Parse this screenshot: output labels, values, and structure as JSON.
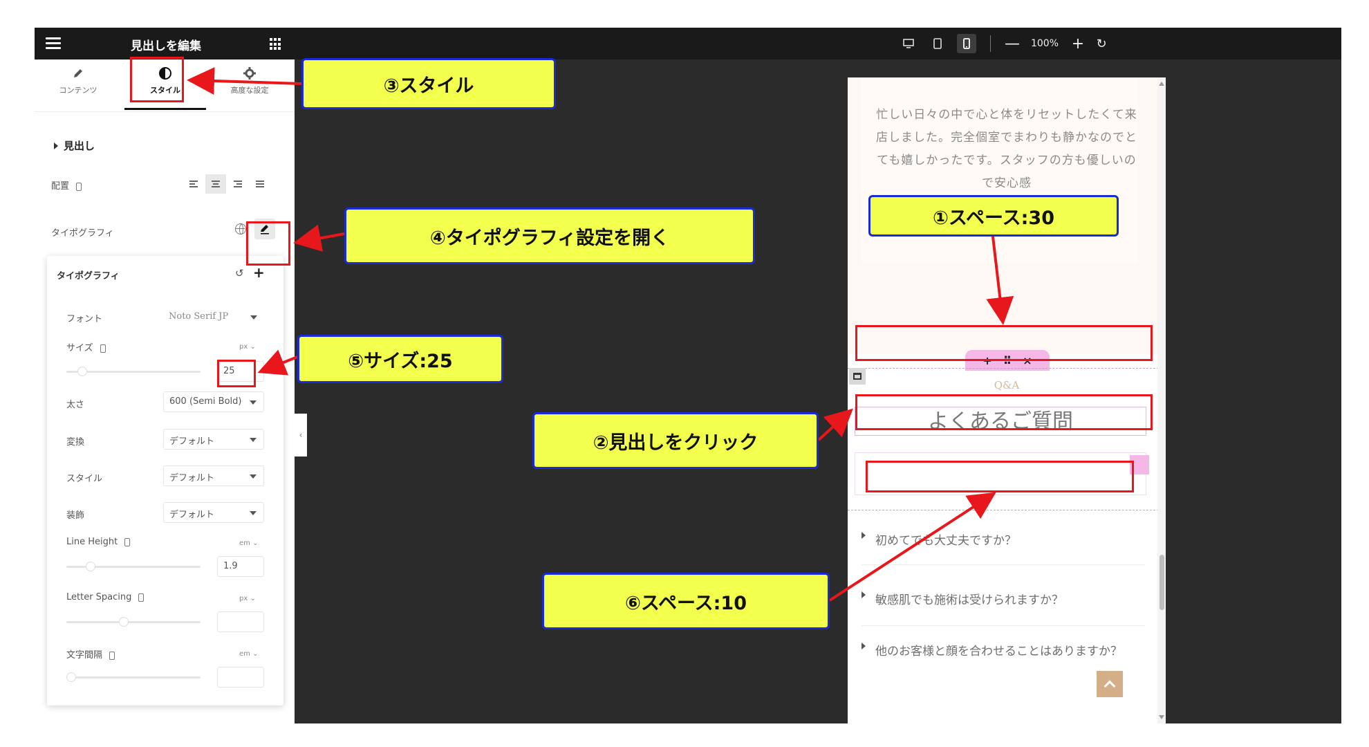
{
  "topbar": {
    "title": "見出しを編集",
    "zoom": "100%",
    "minus": "—",
    "plus": "+",
    "undo": "↻"
  },
  "tabs": [
    {
      "label": "コンテンツ",
      "icon": "pencil-icon"
    },
    {
      "label": "スタイル",
      "icon": "contrast-icon"
    },
    {
      "label": "高度な設定",
      "icon": "gear-icon"
    }
  ],
  "section": {
    "heading": "見出し",
    "align_label": "配置",
    "typography_label": "タイポグラフィ"
  },
  "typography": {
    "title": "タイポグラフィ",
    "reset": "↺",
    "add": "+",
    "font_label": "フォント",
    "font_value": "Noto Serif JP",
    "size_label": "サイズ",
    "size_unit": "px ⌄",
    "size_value": "25",
    "weight_label": "太さ",
    "weight_value": "600 (Semi Bold)",
    "transform_label": "変換",
    "transform_value": "デフォルト",
    "style_label": "スタイル",
    "style_value": "デフォルト",
    "decoration_label": "装飾",
    "decoration_value": "デフォルト",
    "line_height_label": "Line Height",
    "line_height_unit": "em ⌄",
    "line_height_value": "1.9",
    "letter_spacing_label": "Letter Spacing",
    "letter_spacing_unit": "px ⌄",
    "word_spacing_label": "文字間隔",
    "word_spacing_unit": "em ⌄"
  },
  "preview": {
    "testimonial_text": "忙しい日々の中で心と体をリセットしたくて来店しました。完全個室でまわりも静かなのでとても嬉しかったです。スタッフの方も優しいので安心感",
    "handle_plus": "+",
    "handle_move": "⠿",
    "handle_close": "×",
    "kicker": "Q&A",
    "heading": "よくあるご質問",
    "faq": [
      "初めてでも大丈夫ですか？",
      "敏感肌でも施術は受けられますか？",
      "他のお客様と顔を合わせることはありますか？"
    ]
  },
  "annotations": {
    "c1": "①スペース:30",
    "c2": "②見出しをクリック",
    "c3": "③スタイル",
    "c4": "④タイポグラフィ設定を開く",
    "c5": "⑤サイズ:25",
    "c6": "⑥スペース:10"
  },
  "colors": {
    "callout_bg": "#f3ff4d",
    "callout_border": "#1a2bd6",
    "highlight_red": "#e8171b",
    "accent_pink": "#f5b8e6",
    "accent_gold": "#d4ae87"
  }
}
